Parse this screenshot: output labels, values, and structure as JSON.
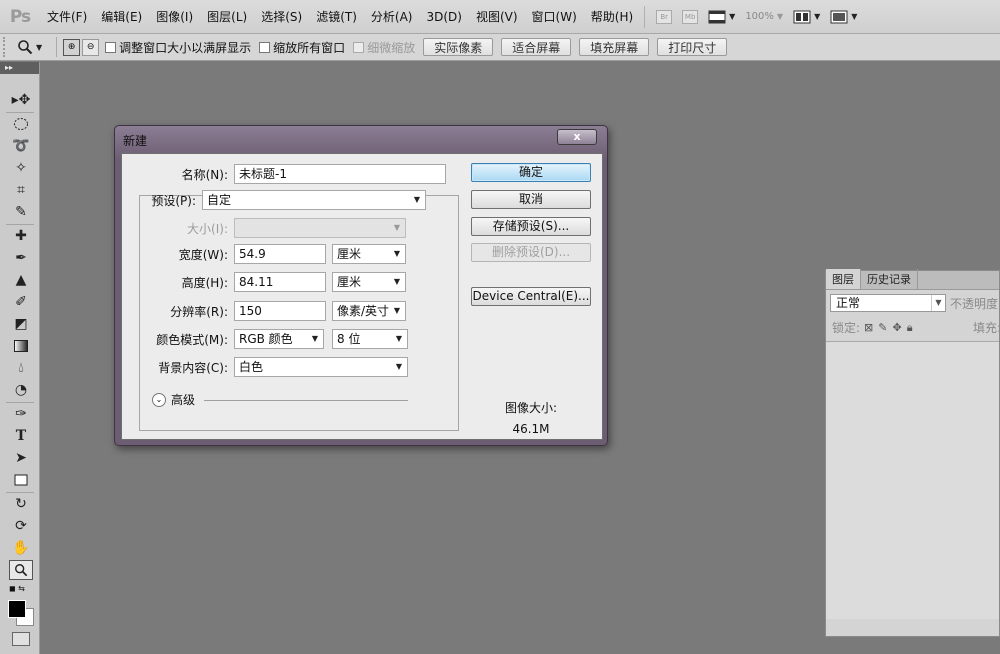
{
  "app": {
    "logo": "Ps",
    "menu": [
      "文件(F)",
      "编辑(E)",
      "图像(I)",
      "图层(L)",
      "选择(S)",
      "滤镜(T)",
      "分析(A)",
      "3D(D)",
      "视图(V)",
      "窗口(W)",
      "帮助(H)"
    ],
    "bridge_label": "Br",
    "minibridge_label": "Mb",
    "zoom_level": "100%"
  },
  "options_bar": {
    "resize_windows_label": "调整窗口大小以满屏显示",
    "zoom_all_windows_label": "缩放所有窗口",
    "scrubby_zoom_label": "细微缩放",
    "actual_pixels": "实际像素",
    "fit_screen": "适合屏幕",
    "fill_screen": "填充屏幕",
    "print_size": "打印尺寸"
  },
  "layers_panel": {
    "tab_layers": "图层",
    "tab_history": "历史记录",
    "blend_mode": "正常",
    "opacity_label": "不透明度:",
    "lock_label": "锁定:",
    "fill_label": "填充:"
  },
  "dialog": {
    "title": "新建",
    "close": "x",
    "name_label": "名称(N):",
    "name_value": "未标题-1",
    "preset_label": "预设(P):",
    "preset_value": "自定",
    "size_label": "大小(I):",
    "width_label": "宽度(W):",
    "width_value": "54.9",
    "width_unit": "厘米",
    "height_label": "高度(H):",
    "height_value": "84.11",
    "height_unit": "厘米",
    "resolution_label": "分辨率(R):",
    "resolution_value": "150",
    "resolution_unit": "像素/英寸",
    "color_mode_label": "颜色模式(M):",
    "color_mode_value": "RGB 颜色",
    "bit_depth": "8 位",
    "background_label": "背景内容(C):",
    "background_value": "白色",
    "advanced_label": "高级",
    "ok": "确定",
    "cancel": "取消",
    "save_preset": "存储预设(S)...",
    "delete_preset": "删除预设(D)...",
    "device_central": "Device Central(E)...",
    "image_size_label": "图像大小:",
    "image_size_value": "46.1M"
  }
}
